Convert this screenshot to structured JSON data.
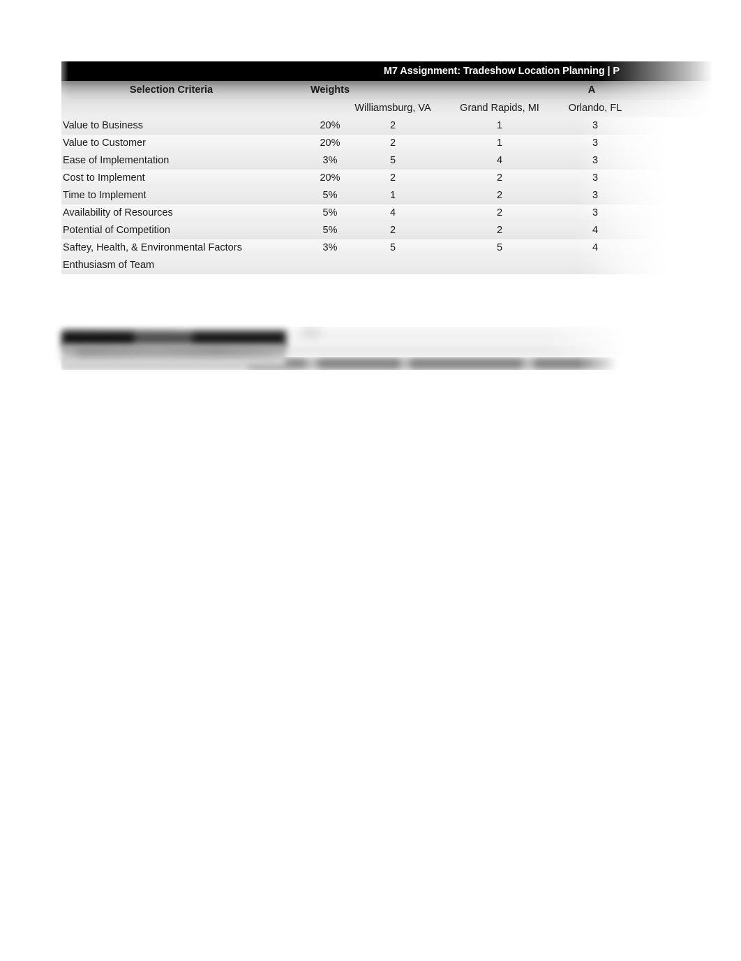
{
  "document": {
    "title_bar": "M7 Assignment: Tradeshow Location Planning | P"
  },
  "matrix": {
    "headers": {
      "criteria": "Selection Criteria",
      "weights": "Weights",
      "alternatives": "A"
    },
    "locations": [
      "Williamsburg, VA",
      "Grand Rapids, MI",
      "Orlando, FL"
    ],
    "rows": [
      {
        "criteria": "Value to Business",
        "weight": "20%",
        "scores": [
          "2",
          "1",
          "3"
        ]
      },
      {
        "criteria": "Value to Customer",
        "weight": "20%",
        "scores": [
          "2",
          "1",
          "3"
        ]
      },
      {
        "criteria": "Ease of Implementation",
        "weight": "3%",
        "scores": [
          "5",
          "4",
          "3"
        ]
      },
      {
        "criteria": "Cost to Implement",
        "weight": "20%",
        "scores": [
          "2",
          "2",
          "3"
        ]
      },
      {
        "criteria": "Time to Implement",
        "weight": "5%",
        "scores": [
          "1",
          "2",
          "3"
        ]
      },
      {
        "criteria": "Availability of Resources",
        "weight": "5%",
        "scores": [
          "4",
          "2",
          "3"
        ]
      },
      {
        "criteria": "Potential of Competition",
        "weight": "5%",
        "scores": [
          "2",
          "2",
          "4"
        ]
      },
      {
        "criteria": "Saftey, Health, & Environmental Factors",
        "weight": "3%",
        "scores": [
          "5",
          "5",
          "4"
        ]
      },
      {
        "criteria": "Enthusiasm of Team",
        "weight": "",
        "scores": [
          "",
          "",
          ""
        ]
      }
    ]
  },
  "colors": {
    "title_bar_bg": "#000000",
    "title_bar_text": "#ffffff",
    "header_band_top": "#7d7d7d",
    "header_band_bottom": "#dcdcdc",
    "row_odd_bg": "#ebebeb",
    "row_even_bg": "#f3f3f3",
    "body_text": "#1a1a1a",
    "page_bg": "#ffffff"
  }
}
